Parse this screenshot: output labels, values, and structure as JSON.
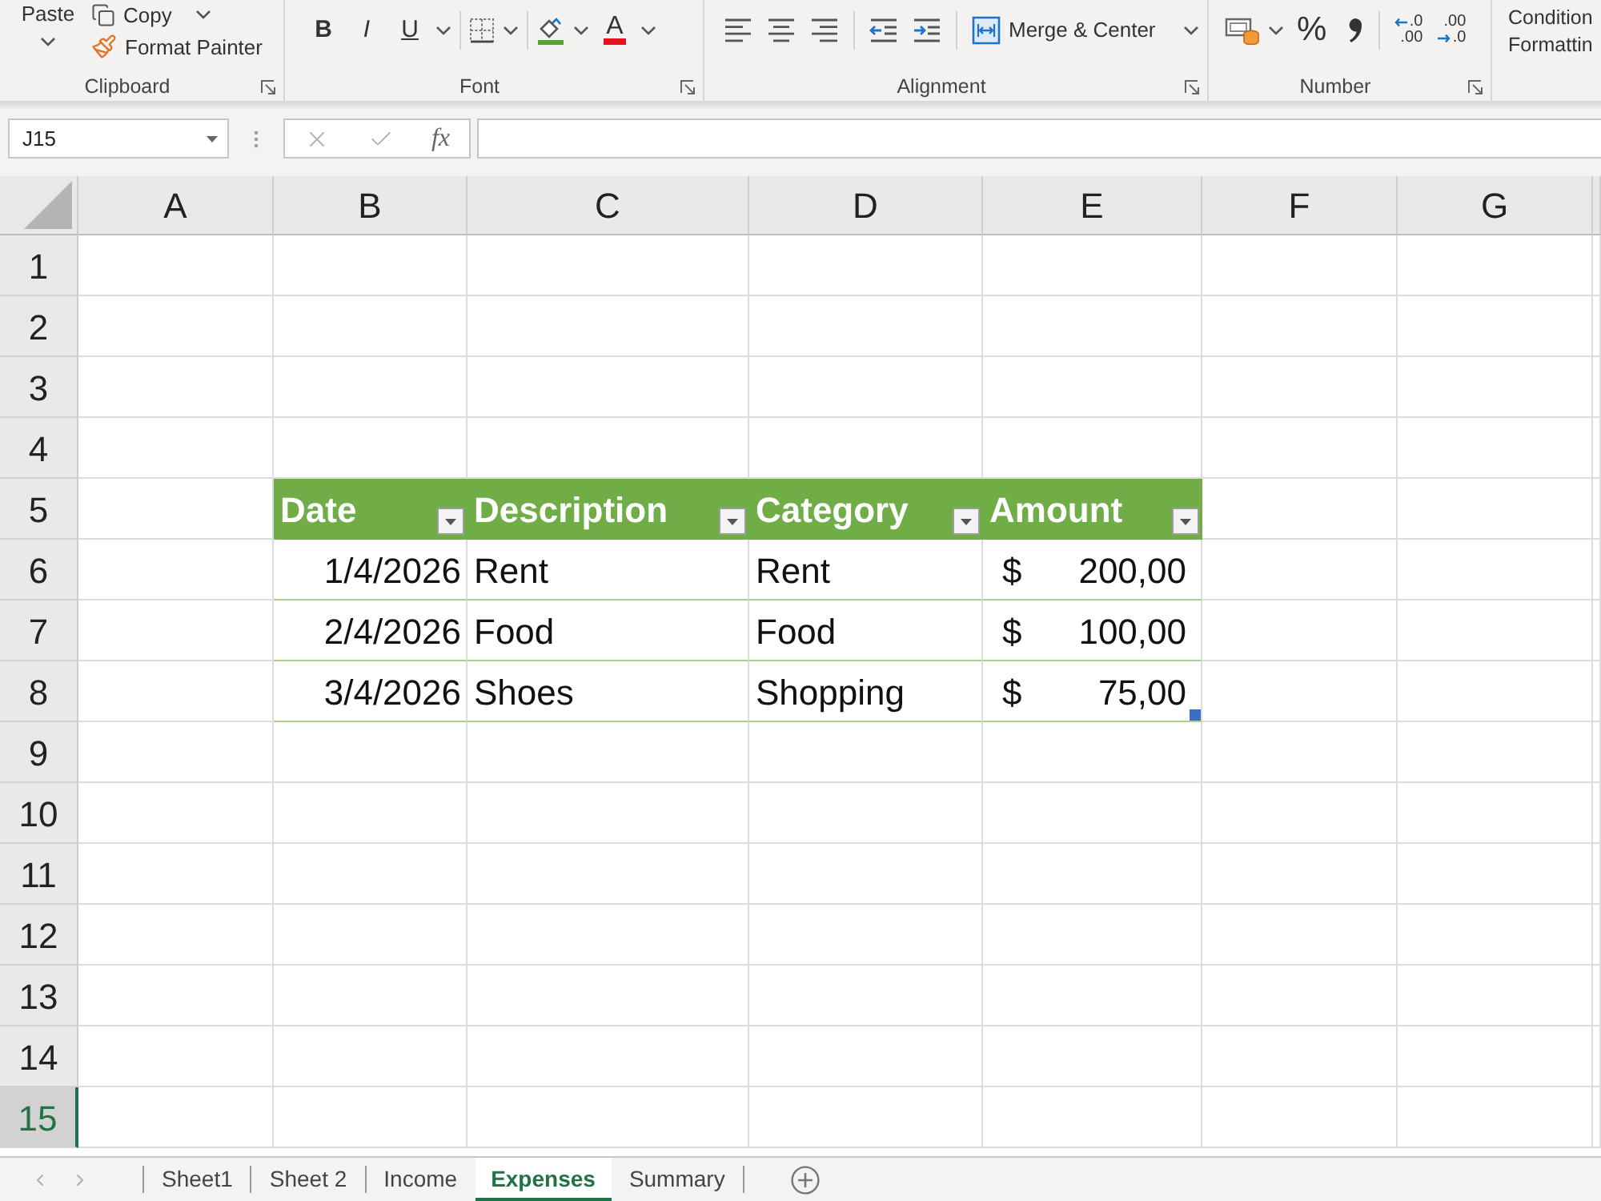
{
  "ribbon": {
    "clipboard": {
      "paste": "Paste",
      "copy": "Copy",
      "format_painter": "Format Painter",
      "label": "Clipboard"
    },
    "font": {
      "bold": "B",
      "italic": "I",
      "underline": "U",
      "font_color": "A",
      "label": "Font"
    },
    "alignment": {
      "merge": "Merge & Center",
      "label": "Alignment"
    },
    "number": {
      "percent": "%",
      "increase_decimal": {
        "top": ".0",
        "bottom": ".00"
      },
      "decrease_decimal": {
        "top": ".00",
        "bottom": ".0"
      },
      "label": "Number"
    },
    "styles": {
      "conditional_formatting": [
        "Condition",
        "Formattin"
      ]
    }
  },
  "formula_bar": {
    "name_box": "J15",
    "function_label": "fx"
  },
  "grid": {
    "columns": [
      "A",
      "B",
      "C",
      "D",
      "E",
      "F",
      "G"
    ],
    "rows": [
      {
        "label": "1",
        "selected": false
      },
      {
        "label": "2",
        "selected": false
      },
      {
        "label": "3",
        "selected": false
      },
      {
        "label": "4",
        "selected": false
      },
      {
        "label": "5",
        "selected": false
      },
      {
        "label": "6",
        "selected": false
      },
      {
        "label": "7",
        "selected": false
      },
      {
        "label": "8",
        "selected": false
      },
      {
        "label": "9",
        "selected": false
      },
      {
        "label": "10",
        "selected": false
      },
      {
        "label": "11",
        "selected": false
      },
      {
        "label": "12",
        "selected": false
      },
      {
        "label": "13",
        "selected": false
      },
      {
        "label": "14",
        "selected": false
      },
      {
        "label": "15",
        "selected": true
      }
    ]
  },
  "table": {
    "headers": [
      "Date",
      "Description",
      "Category",
      "Amount"
    ],
    "rows": [
      {
        "date": "1/4/2026",
        "description": "Rent",
        "category": "Rent",
        "currency": "$",
        "amount": "200,00"
      },
      {
        "date": "2/4/2026",
        "description": "Food",
        "category": "Food",
        "currency": "$",
        "amount": "100,00"
      },
      {
        "date": "3/4/2026",
        "description": "Shoes",
        "category": "Shopping",
        "currency": "$",
        "amount": "75,00"
      }
    ]
  },
  "sheet_tabs": [
    {
      "label": "Sheet1",
      "selected": false
    },
    {
      "label": "Sheet 2",
      "selected": false
    },
    {
      "label": "Income",
      "selected": false
    },
    {
      "label": "Expenses",
      "selected": true
    },
    {
      "label": "Summary",
      "selected": false
    }
  ]
}
